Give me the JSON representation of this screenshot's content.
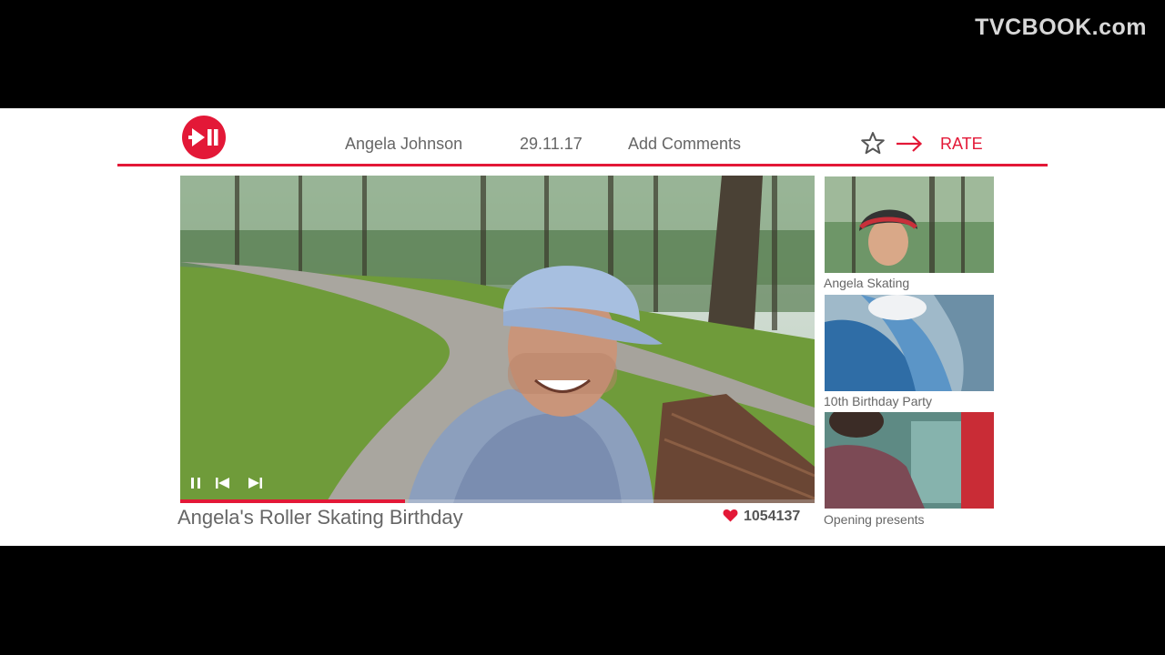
{
  "watermark": "TVCBOOK.com",
  "header": {
    "author": "Angela Johnson",
    "date": "29.11.17",
    "comments_label": "Add Comments",
    "rate_label": "RATE"
  },
  "player": {
    "title": "Angela's Roller Skating Birthday",
    "likes": "1054137",
    "progress": 0.355
  },
  "playlist": [
    {
      "label": "Angela Skating"
    },
    {
      "label": "10th Birthday Party"
    },
    {
      "label": "Opening presents"
    }
  ],
  "colors": {
    "accent": "#e31837",
    "text": "#666666",
    "panel": "#ffffff",
    "background": "#000000"
  },
  "icons": [
    "play-pause-logo-icon",
    "star-icon",
    "arrow-right-icon",
    "heart-icon",
    "pause-icon",
    "skip-back-icon",
    "skip-forward-icon"
  ]
}
